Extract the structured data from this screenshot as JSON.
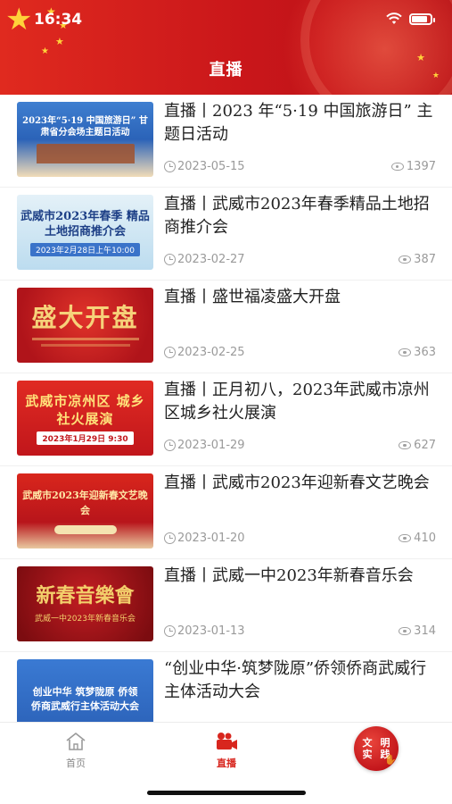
{
  "status_bar": {
    "time": "16:34"
  },
  "header": {
    "title": "直播"
  },
  "items": [
    {
      "title": "直播丨2023 年“5·19 中国旅游日” 主题日活动",
      "date": "2023-05-15",
      "views": "1397",
      "thumb": {
        "line1": "2023年“5·19 中国旅游日” 甘肃省分会场主题日活动",
        "line2": "",
        "bg": "#2b63b8",
        "fg": "#ffffff"
      }
    },
    {
      "title": "直播丨武威市2023年春季精品土地招商推介会",
      "date": "2023-02-27",
      "views": "387",
      "thumb": {
        "line1": "武威市2023年春季 精品土地招商推介会",
        "line2": "2023年2月28日上午10:00",
        "bg": "#cfe6f3",
        "fg": "#1d3f86"
      }
    },
    {
      "title": "直播丨盛世福凌盛大开盘",
      "date": "2023-02-25",
      "views": "363",
      "thumb": {
        "line1": "盛大开盘",
        "line2": "",
        "bg": "#c4171c",
        "fg": "#f6d27a"
      }
    },
    {
      "title": "直播丨正月初八，2023年武威市凉州区城乡社火展演",
      "date": "2023-01-29",
      "views": "627",
      "thumb": {
        "line1": "武威市凉州区 城乡社火展演",
        "line2": "2023年1月29日 9:30",
        "bg": "#d11f1f",
        "fg": "#ffe27a"
      }
    },
    {
      "title": "直播丨武威市2023年迎新春文艺晚会",
      "date": "2023-01-20",
      "views": "410",
      "thumb": {
        "line1": "武威市2023年迎新春文艺晚会",
        "line2": "",
        "bg": "#d9261c",
        "fg": "#ffe9a8"
      }
    },
    {
      "title": "直播丨武威一中2023年新春音乐会",
      "date": "2023-01-13",
      "views": "314",
      "thumb": {
        "line1": "新春音樂會",
        "line2": "武威一中2023年新春音乐会",
        "bg": "#a5121a",
        "fg": "#f3cf6b"
      }
    },
    {
      "title": "“创业中华·筑梦陇原”侨领侨商武威行主体活动大会",
      "date": "",
      "views": "",
      "thumb": {
        "line1": "创业中华 筑梦陇原 侨领侨商武威行主体活动大会",
        "line2": "",
        "bg": "#2a66c4",
        "fg": "#ffffff"
      }
    }
  ],
  "tabbar": {
    "home_label": "首页",
    "live_label": "直播",
    "badge_text": [
      "文",
      "明",
      "实",
      "践"
    ]
  },
  "colors": {
    "brand_red": "#d8261e",
    "meta_gray": "#9a9a9a"
  }
}
